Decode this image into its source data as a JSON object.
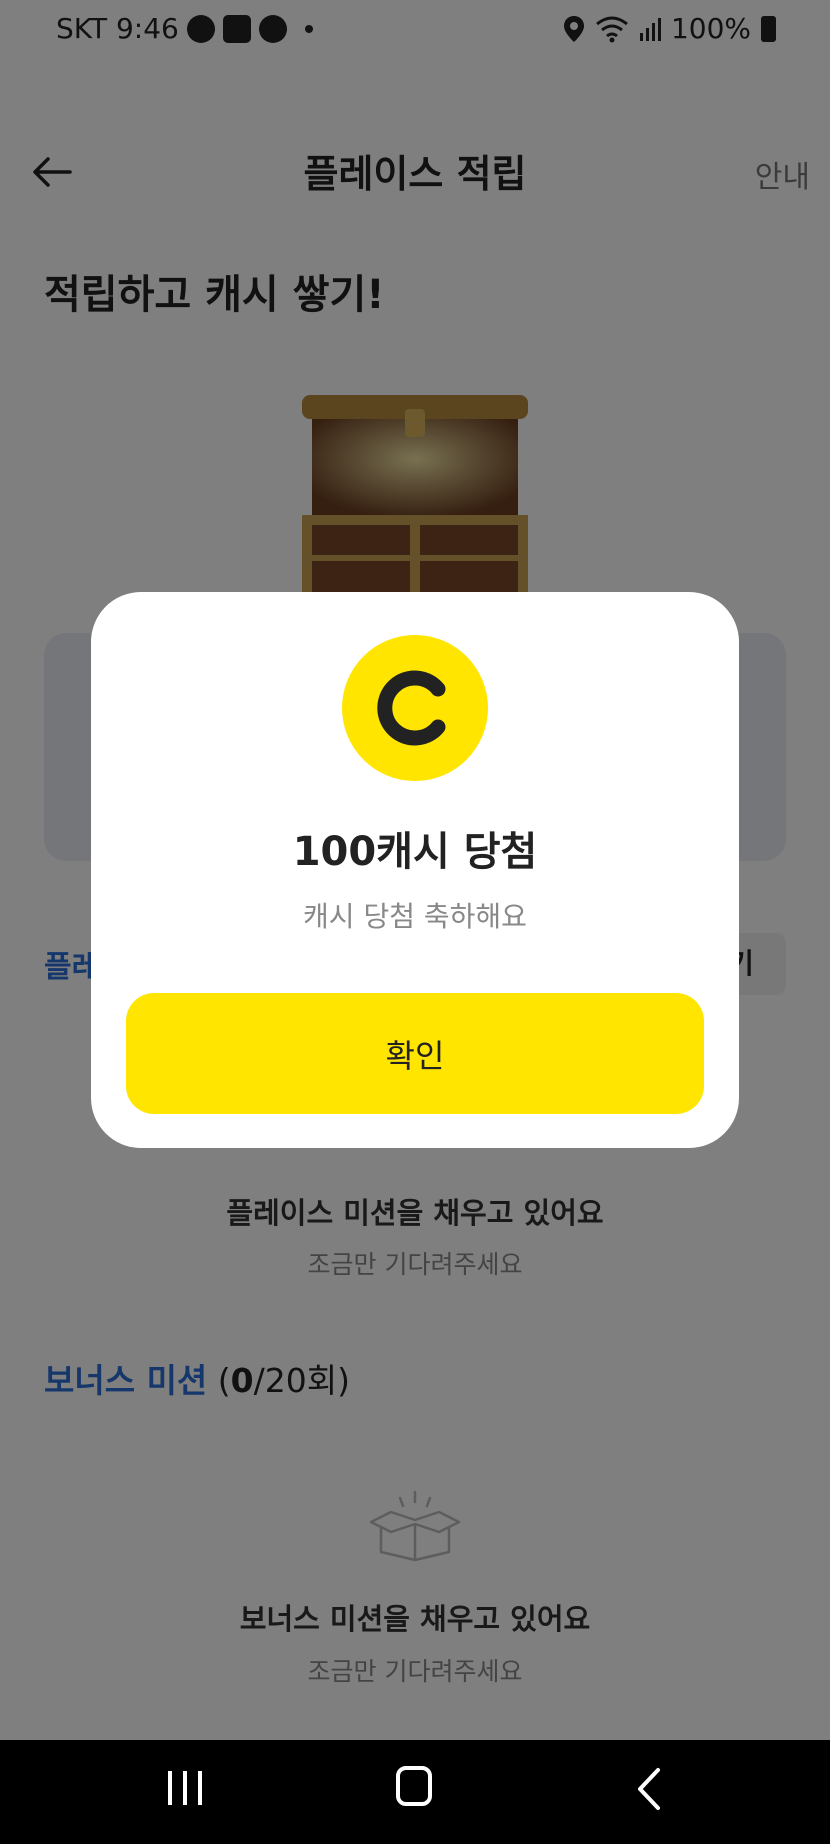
{
  "status_bar": {
    "carrier_time": "SKT 9:46",
    "battery": "100%"
  },
  "header": {
    "title": "플레이스 적립",
    "guide_label": "안내"
  },
  "headline": "적립하고 캐시 쌓기!",
  "place_section": {
    "title": "플레",
    "tab_label": "기"
  },
  "place_empty": {
    "title": "플레이스 미션을 채우고 있어요",
    "subtitle": "조금만 기다려주세요"
  },
  "bonus_section": {
    "title": "보너스 미션",
    "count_open": " (",
    "count_done": "0",
    "count_rest": "/20회)"
  },
  "bonus_empty": {
    "title": "보너스 미션을 채우고 있어요",
    "subtitle": "조금만 기다려주세요"
  },
  "dialog": {
    "title": "100캐시 당첨",
    "subtitle": "캐시 당첨 축하해요",
    "confirm_label": "확인",
    "coin_icon": "cash-c-icon"
  },
  "colors": {
    "accent_blue": "#2c6fd6",
    "brand_yellow": "#ffe500",
    "overlay": "rgba(0,0,0,0.5)"
  }
}
